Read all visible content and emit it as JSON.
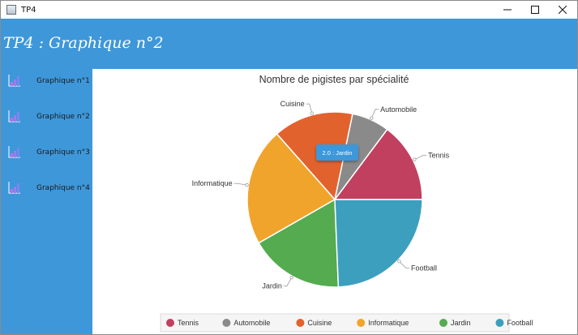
{
  "window": {
    "title": "TP4"
  },
  "header": {
    "title": "TP4 : Graphique n°2"
  },
  "sidebar": {
    "items": [
      {
        "label": "Graphique n°1"
      },
      {
        "label": "Graphique n°2"
      },
      {
        "label": "Graphique n°3"
      },
      {
        "label": "Graphique n°4"
      }
    ]
  },
  "tooltip": {
    "text": "2.0 : Jardin"
  },
  "colors": {
    "accent": "#3e97d9"
  },
  "chart_data": {
    "type": "pie",
    "title": "Nombre de pigistes par spécialité",
    "categories": [
      "Tennis",
      "Automobile",
      "Cuisine",
      "Informatique",
      "Jardin",
      "Football"
    ],
    "values": [
      1.7,
      0.8,
      1.7,
      2.5,
      2.0,
      2.8
    ],
    "colors": [
      "#c2405f",
      "#8a8a8a",
      "#e2622e",
      "#f0a42c",
      "#55ab4f",
      "#3d9fbe"
    ],
    "legend": "bottom"
  }
}
